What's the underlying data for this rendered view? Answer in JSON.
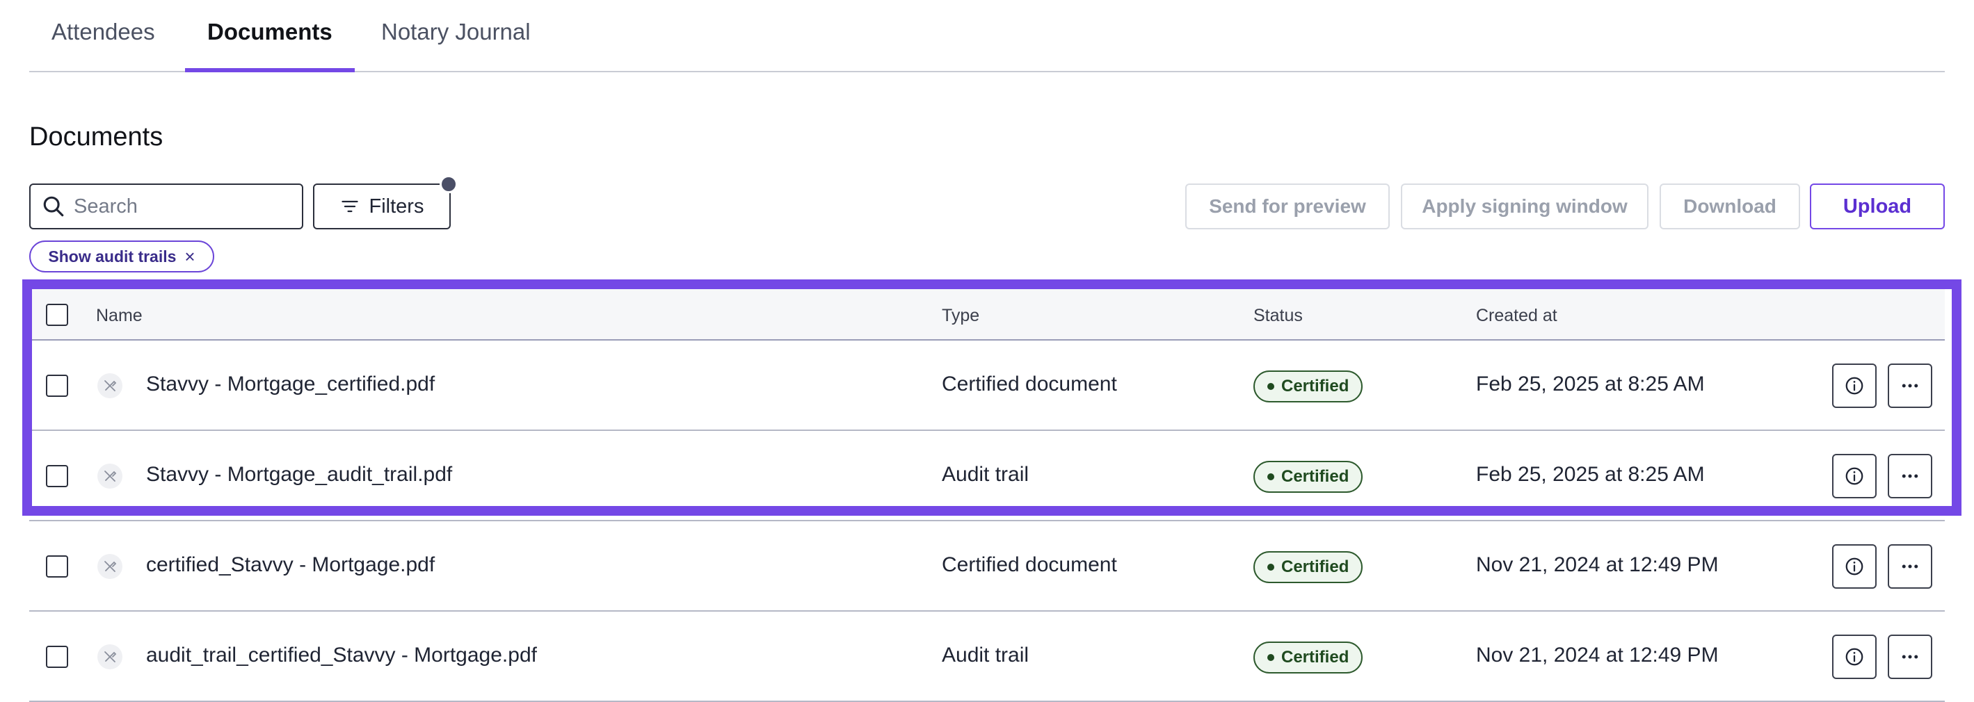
{
  "tabs": [
    {
      "label": "Attendees",
      "active": false
    },
    {
      "label": "Documents",
      "active": true
    },
    {
      "label": "Notary Journal",
      "active": false
    }
  ],
  "section_title": "Documents",
  "toolbar": {
    "search_placeholder": "Search",
    "filters_label": "Filters",
    "send_preview_label": "Send for preview",
    "apply_window_label": "Apply signing window",
    "download_label": "Download",
    "upload_label": "Upload"
  },
  "chip": {
    "label": "Show audit trails",
    "close": "×"
  },
  "table": {
    "headers": {
      "name": "Name",
      "type": "Type",
      "status": "Status",
      "created": "Created at"
    },
    "rows": [
      {
        "name": "Stavvy - Mortgage_certified.pdf",
        "type": "Certified document",
        "status": "Certified",
        "created": "Feb 25, 2025 at 8:25 AM"
      },
      {
        "name": "Stavvy - Mortgage_audit_trail.pdf",
        "type": "Audit trail",
        "status": "Certified",
        "created": "Feb 25, 2025 at 8:25 AM"
      },
      {
        "name": "certified_Stavvy - Mortgage.pdf",
        "type": "Certified document",
        "status": "Certified",
        "created": "Nov 21, 2024 at 12:49 PM"
      },
      {
        "name": "audit_trail_certified_Stavvy - Mortgage.pdf",
        "type": "Audit trail",
        "status": "Certified",
        "created": "Nov 21, 2024 at 12:49 PM"
      }
    ]
  },
  "icons": {
    "search": "search-icon",
    "filter": "filter-icon",
    "file": "file-icon",
    "info": "info-icon",
    "more": "more-icon",
    "close": "close-icon"
  },
  "colors": {
    "accent": "#7448e6",
    "certified_text": "#1f4a1f",
    "certified_bg": "#eef6ee"
  }
}
